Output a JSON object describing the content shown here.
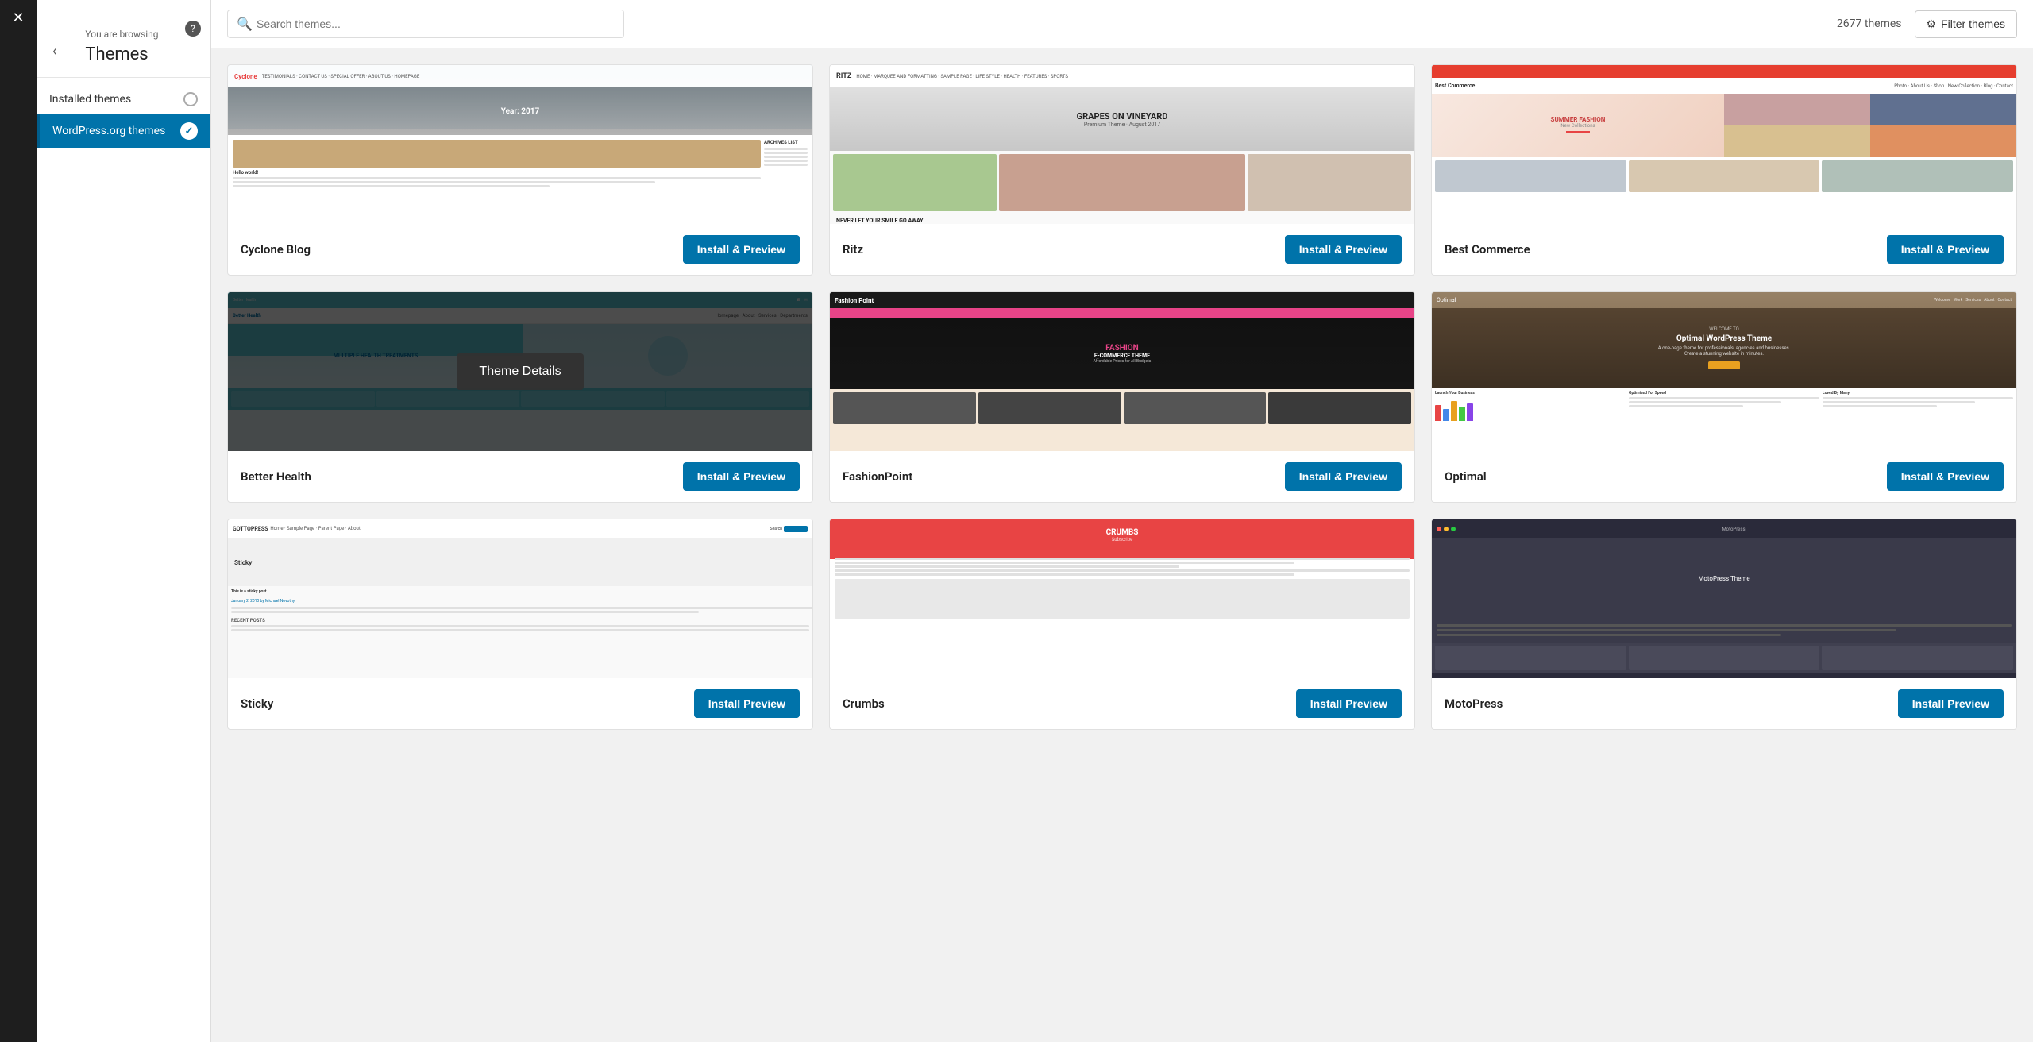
{
  "app": {
    "close_label": "✕",
    "back_label": "‹",
    "help_label": "?"
  },
  "sidebar": {
    "browsing_label": "You are browsing",
    "title": "Themes",
    "items": [
      {
        "id": "installed",
        "label": "Installed themes",
        "active": false
      },
      {
        "id": "wporg",
        "label": "WordPress.org themes",
        "active": true
      }
    ]
  },
  "topbar": {
    "search_placeholder": "Search themes...",
    "theme_count": "2677 themes",
    "filter_label": "Filter themes"
  },
  "themes": [
    {
      "id": "cyclone-blog",
      "name": "Cyclone Blog",
      "install_label": "Install & Preview",
      "style": "cyclone",
      "has_overlay": false
    },
    {
      "id": "ritz",
      "name": "Ritz",
      "install_label": "Install & Preview",
      "style": "ritz",
      "has_overlay": false
    },
    {
      "id": "best-commerce",
      "name": "Best Commerce",
      "install_label": "Install & Preview",
      "style": "bestcommerce",
      "has_overlay": false
    },
    {
      "id": "better-health",
      "name": "Better Health",
      "install_label": "Install & Preview",
      "style": "betterhealth",
      "has_overlay": true,
      "overlay_label": "Theme Details"
    },
    {
      "id": "fashionpoint",
      "name": "FashionPoint",
      "install_label": "Install & Preview",
      "style": "fashionpoint",
      "has_overlay": false
    },
    {
      "id": "optimal",
      "name": "Optimal",
      "install_label": "Install & Preview",
      "style": "optimal",
      "has_overlay": false
    },
    {
      "id": "sticky",
      "name": "Sticky",
      "install_label": "Install Preview",
      "style": "sticky",
      "has_overlay": false
    },
    {
      "id": "crumbs",
      "name": "Crumbs",
      "install_label": "Install Preview",
      "style": "crumbs",
      "has_overlay": false
    },
    {
      "id": "motopress",
      "name": "MotoPress",
      "install_label": "Install Preview",
      "style": "motopress",
      "has_overlay": false
    }
  ]
}
